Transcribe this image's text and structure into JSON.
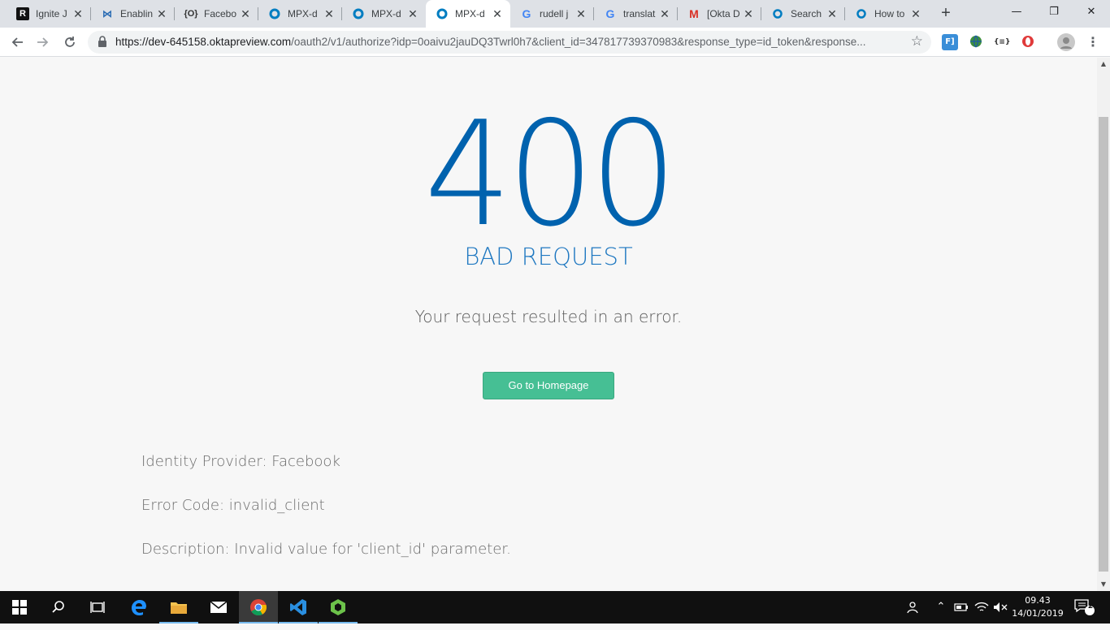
{
  "tabs": [
    {
      "title": "Ignite J",
      "icon": "r-icon"
    },
    {
      "title": "Enablin",
      "icon": "bow-icon"
    },
    {
      "title": "Facebo",
      "icon": "brackets-icon"
    },
    {
      "title": "MPX-d",
      "icon": "okta-icon"
    },
    {
      "title": "MPX-d",
      "icon": "okta-icon"
    },
    {
      "title": "MPX-d",
      "icon": "okta-icon"
    },
    {
      "title": "rudell j",
      "icon": "google-icon"
    },
    {
      "title": "translat",
      "icon": "google-icon"
    },
    {
      "title": "[Okta D",
      "icon": "gmail-icon"
    },
    {
      "title": "Search",
      "icon": "okta-icon"
    },
    {
      "title": "How to",
      "icon": "okta-icon"
    }
  ],
  "active_tab_index": 5,
  "address": {
    "host": "https://dev-645158.oktapreview.com",
    "path": "/oauth2/v1/authorize?idp=0oaivu2jauDQ3Twrl0h7&client_id=347817739370983&response_type=id_token&response..."
  },
  "error": {
    "code": "400",
    "title": "BAD REQUEST",
    "subtitle": "Your request resulted in an error.",
    "button_label": "Go to Homepage"
  },
  "details": {
    "identity_provider": "Identity Provider: Facebook",
    "error_code": "Error Code: invalid_client",
    "description": "Description: Invalid value for 'client_id' parameter."
  },
  "clock": {
    "time": "09.43",
    "date": "14/01/2019"
  },
  "notifications_count": "2",
  "colors": {
    "error_blue": "#0062ae",
    "button_green": "#46bf94"
  }
}
